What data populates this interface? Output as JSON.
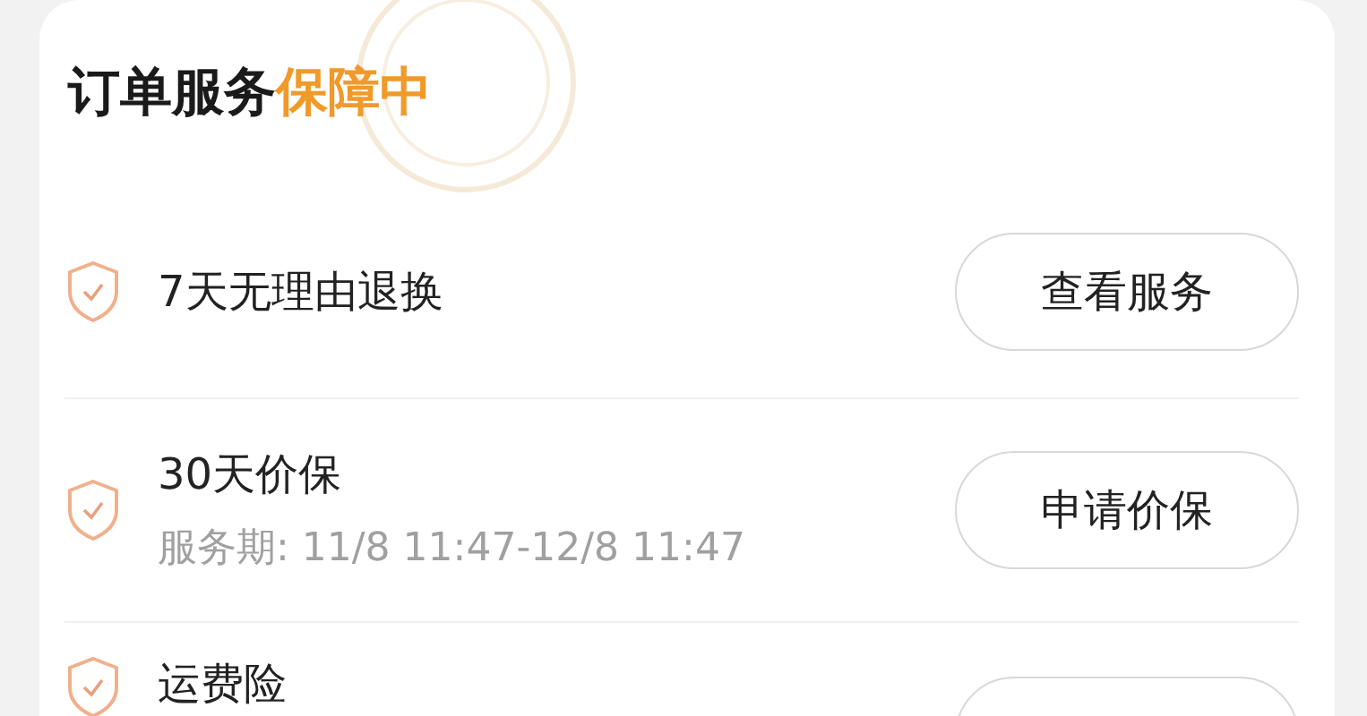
{
  "header": {
    "title": "订单服务",
    "status": "保障中"
  },
  "services": [
    {
      "name": "7天无理由退换",
      "button": {
        "kind": "outline",
        "label": "查看服务"
      }
    },
    {
      "name": "30天价保",
      "period": "服务期: 11/8 11:47-12/8 11:47",
      "button": {
        "kind": "outline",
        "label": "申请价保"
      }
    },
    {
      "name": "运费险",
      "button": {
        "kind": "outline"
      }
    }
  ]
}
